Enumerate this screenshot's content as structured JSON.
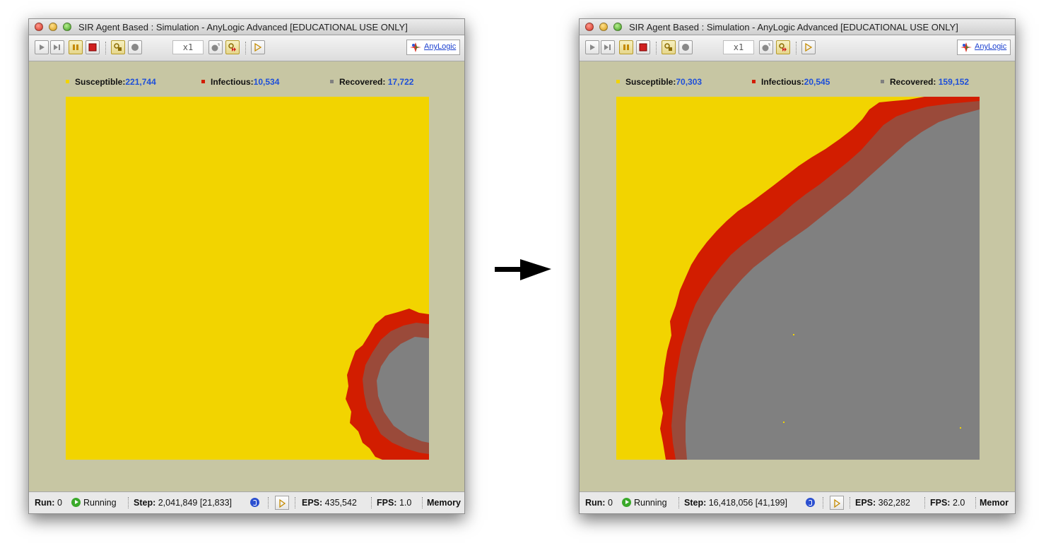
{
  "colors": {
    "susceptible": "#f2d400",
    "infectious": "#d21d00",
    "recovered": "#808080",
    "panel_bg": "#c7c6a3",
    "value_text": "#1e4fd9"
  },
  "arrow": {
    "icon": "right-arrow-icon"
  },
  "windows": [
    {
      "title": "SIR Agent Based : Simulation - AnyLogic Advanced [EDUCATIONAL USE ONLY]",
      "toolbar": {
        "speed": "x1",
        "brand": "AnyLogic"
      },
      "legend": {
        "susceptible_label": "Susceptible:",
        "susceptible_value": "221,744",
        "infectious_label": "Infectious:",
        "infectious_value": "10,534",
        "recovered_label": "Recovered:",
        "recovered_value": "17,722"
      },
      "status": {
        "run_label": "Run:",
        "run_value": "0",
        "run_state": "Running",
        "step_label": "Step:",
        "step_value": "2,041,849 [21,833]",
        "eps_label": "EPS:",
        "eps_value": "435,542",
        "fps_label": "FPS:",
        "fps_value": "1.0",
        "memory_label": "Memory"
      }
    },
    {
      "title": "SIR Agent Based : Simulation - AnyLogic Advanced [EDUCATIONAL USE ONLY]",
      "toolbar": {
        "speed": "x1",
        "brand": "AnyLogic"
      },
      "legend": {
        "susceptible_label": "Susceptible:",
        "susceptible_value": "70,303",
        "infectious_label": "Infectious:",
        "infectious_value": "20,545",
        "recovered_label": "Recovered:",
        "recovered_value": "159,152"
      },
      "status": {
        "run_label": "Run:",
        "run_value": "0",
        "run_state": "Running",
        "step_label": "Step:",
        "step_value": "16,418,056 [41,199]",
        "eps_label": "EPS:",
        "eps_value": "362,282",
        "fps_label": "FPS:",
        "fps_value": "2.0",
        "memory_label": "Memor"
      }
    }
  ]
}
